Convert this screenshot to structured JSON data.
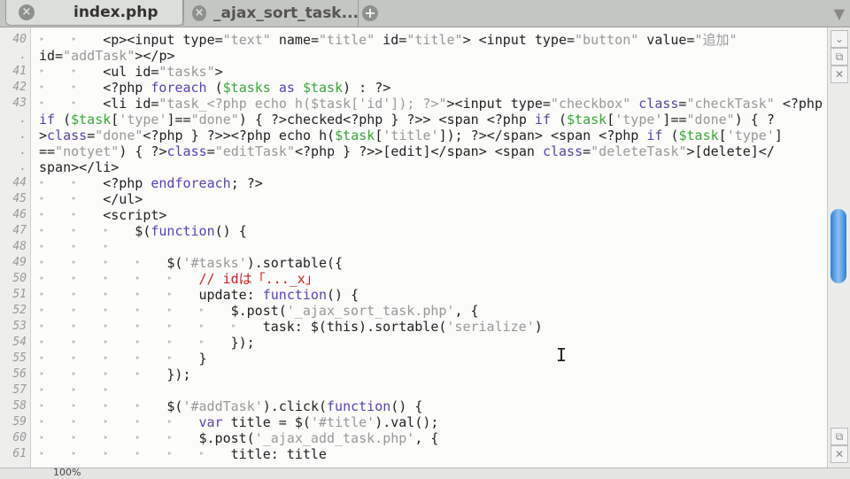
{
  "tabs": [
    {
      "label": "index.php",
      "active": true
    },
    {
      "label": "_ajax_sort_task...",
      "active": false
    }
  ],
  "status": {
    "zoom": "100%"
  },
  "lines": [
    {
      "num": "40",
      "indent": 2,
      "seg": [
        [
          "<p><input type=",
          ""
        ],
        [
          "\"text\"",
          "s"
        ],
        [
          " name=",
          ""
        ],
        [
          "\"title\"",
          "s"
        ],
        [
          " id=",
          ""
        ],
        [
          "\"title\"",
          "s"
        ],
        [
          "> <input type=",
          ""
        ],
        [
          "\"button\"",
          "s"
        ],
        [
          " value=",
          ""
        ],
        [
          "\"追加\"",
          "s"
        ]
      ]
    },
    {
      "num": "",
      "indent": 0,
      "seg": [
        [
          "id=",
          ""
        ],
        [
          "\"addTask\"",
          "s"
        ],
        [
          "></p>",
          ""
        ]
      ]
    },
    {
      "num": "41",
      "indent": 2,
      "seg": [
        [
          "<ul id=",
          ""
        ],
        [
          "\"tasks\"",
          "s"
        ],
        [
          ">",
          ""
        ]
      ]
    },
    {
      "num": "42",
      "indent": 2,
      "seg": [
        [
          "<?php ",
          ""
        ],
        [
          "foreach",
          "k"
        ],
        [
          " (",
          ""
        ],
        [
          "$tasks",
          "v"
        ],
        [
          " ",
          ""
        ],
        [
          "as",
          "k"
        ],
        [
          " ",
          ""
        ],
        [
          "$task",
          "v"
        ],
        [
          ") : ?>",
          ""
        ]
      ]
    },
    {
      "num": "43",
      "indent": 2,
      "seg": [
        [
          "<li id=",
          ""
        ],
        [
          "\"task_<?php echo h($task['id']); ?>\"",
          "s"
        ],
        [
          "><input type=",
          ""
        ],
        [
          "\"checkbox\"",
          "s"
        ],
        [
          " ",
          ""
        ],
        [
          "class",
          "k"
        ],
        [
          "=",
          ""
        ],
        [
          "\"checkTask\"",
          "s"
        ],
        [
          " <?php",
          ""
        ]
      ]
    },
    {
      "num": "",
      "indent": 0,
      "seg": [
        [
          "if",
          "k"
        ],
        [
          " (",
          ""
        ],
        [
          "$task",
          "v"
        ],
        [
          "[",
          ""
        ],
        [
          "'type'",
          "s"
        ],
        [
          "]==",
          ""
        ],
        [
          "\"done\"",
          "s"
        ],
        [
          ") { ?>checked<?php } ?>> <span <?php ",
          ""
        ],
        [
          "if",
          "k"
        ],
        [
          " (",
          ""
        ],
        [
          "$task",
          "v"
        ],
        [
          "[",
          ""
        ],
        [
          "'type'",
          "s"
        ],
        [
          "]==",
          ""
        ],
        [
          "\"done\"",
          "s"
        ],
        [
          ") { ?",
          ""
        ]
      ]
    },
    {
      "num": "",
      "indent": 0,
      "seg": [
        [
          ">",
          ""
        ],
        [
          "class",
          "k"
        ],
        [
          "=",
          ""
        ],
        [
          "\"done\"",
          "s"
        ],
        [
          "<?php } ?>><?php echo h(",
          ""
        ],
        [
          "$task",
          "v"
        ],
        [
          "[",
          ""
        ],
        [
          "'title'",
          "s"
        ],
        [
          "]); ?></span> <span <?php ",
          ""
        ],
        [
          "if",
          "k"
        ],
        [
          " (",
          ""
        ],
        [
          "$task",
          "v"
        ],
        [
          "[",
          ""
        ],
        [
          "'type'",
          "s"
        ],
        [
          "]",
          ""
        ]
      ]
    },
    {
      "num": "",
      "indent": 0,
      "seg": [
        [
          "==",
          ""
        ],
        [
          "\"notyet\"",
          "s"
        ],
        [
          ") { ?>",
          ""
        ],
        [
          "class",
          "k"
        ],
        [
          "=",
          ""
        ],
        [
          "\"editTask\"",
          "s"
        ],
        [
          "<?php } ?>>[edit]</span> <span ",
          ""
        ],
        [
          "class",
          "k"
        ],
        [
          "=",
          ""
        ],
        [
          "\"deleteTask\"",
          "s"
        ],
        [
          ">[delete]</",
          ""
        ]
      ]
    },
    {
      "num": "",
      "indent": 0,
      "seg": [
        [
          "span></li>",
          ""
        ]
      ]
    },
    {
      "num": "44",
      "indent": 2,
      "seg": [
        [
          "<?php ",
          ""
        ],
        [
          "endforeach",
          "k"
        ],
        [
          "; ?>",
          ""
        ]
      ]
    },
    {
      "num": "45",
      "indent": 2,
      "seg": [
        [
          "</ul>",
          ""
        ]
      ]
    },
    {
      "num": "46",
      "indent": 2,
      "seg": [
        [
          "<script>",
          ""
        ]
      ]
    },
    {
      "num": "47",
      "indent": 3,
      "seg": [
        [
          "$(",
          ""
        ],
        [
          "function",
          "k"
        ],
        [
          "() {",
          ""
        ]
      ]
    },
    {
      "num": "48",
      "indent": 3,
      "seg": []
    },
    {
      "num": "49",
      "indent": 4,
      "seg": [
        [
          "$(",
          ""
        ],
        [
          "'#tasks'",
          "s"
        ],
        [
          ").sortable({",
          ""
        ]
      ]
    },
    {
      "num": "50",
      "indent": 5,
      "seg": [
        [
          "// idは「..._x」",
          "c"
        ]
      ]
    },
    {
      "num": "51",
      "indent": 5,
      "seg": [
        [
          "update: ",
          ""
        ],
        [
          "function",
          "k"
        ],
        [
          "() {",
          ""
        ]
      ]
    },
    {
      "num": "52",
      "indent": 6,
      "seg": [
        [
          "$.post(",
          ""
        ],
        [
          "'_ajax_sort_task.php'",
          "s"
        ],
        [
          ", {",
          ""
        ]
      ]
    },
    {
      "num": "53",
      "indent": 7,
      "seg": [
        [
          "task: $(this).sortable(",
          ""
        ],
        [
          "'serialize'",
          "s"
        ],
        [
          ")",
          ""
        ]
      ]
    },
    {
      "num": "54",
      "indent": 6,
      "seg": [
        [
          "});",
          ""
        ]
      ]
    },
    {
      "num": "55",
      "indent": 5,
      "seg": [
        [
          "}",
          ""
        ]
      ]
    },
    {
      "num": "56",
      "indent": 4,
      "seg": [
        [
          "});",
          ""
        ]
      ]
    },
    {
      "num": "57",
      "indent": 3,
      "seg": []
    },
    {
      "num": "58",
      "indent": 4,
      "seg": [
        [
          "$(",
          ""
        ],
        [
          "'#addTask'",
          "s"
        ],
        [
          ").click(",
          ""
        ],
        [
          "function",
          "k"
        ],
        [
          "() {",
          ""
        ]
      ]
    },
    {
      "num": "59",
      "indent": 5,
      "seg": [
        [
          "var",
          "k"
        ],
        [
          " title = $(",
          ""
        ],
        [
          "'#title'",
          "s"
        ],
        [
          ").val();",
          ""
        ]
      ]
    },
    {
      "num": "60",
      "indent": 5,
      "seg": [
        [
          "$.post(",
          ""
        ],
        [
          "'_ajax_add_task.php'",
          "s"
        ],
        [
          ", {",
          ""
        ]
      ]
    },
    {
      "num": "61",
      "indent": 6,
      "seg": [
        [
          "title: title",
          ""
        ]
      ]
    }
  ]
}
